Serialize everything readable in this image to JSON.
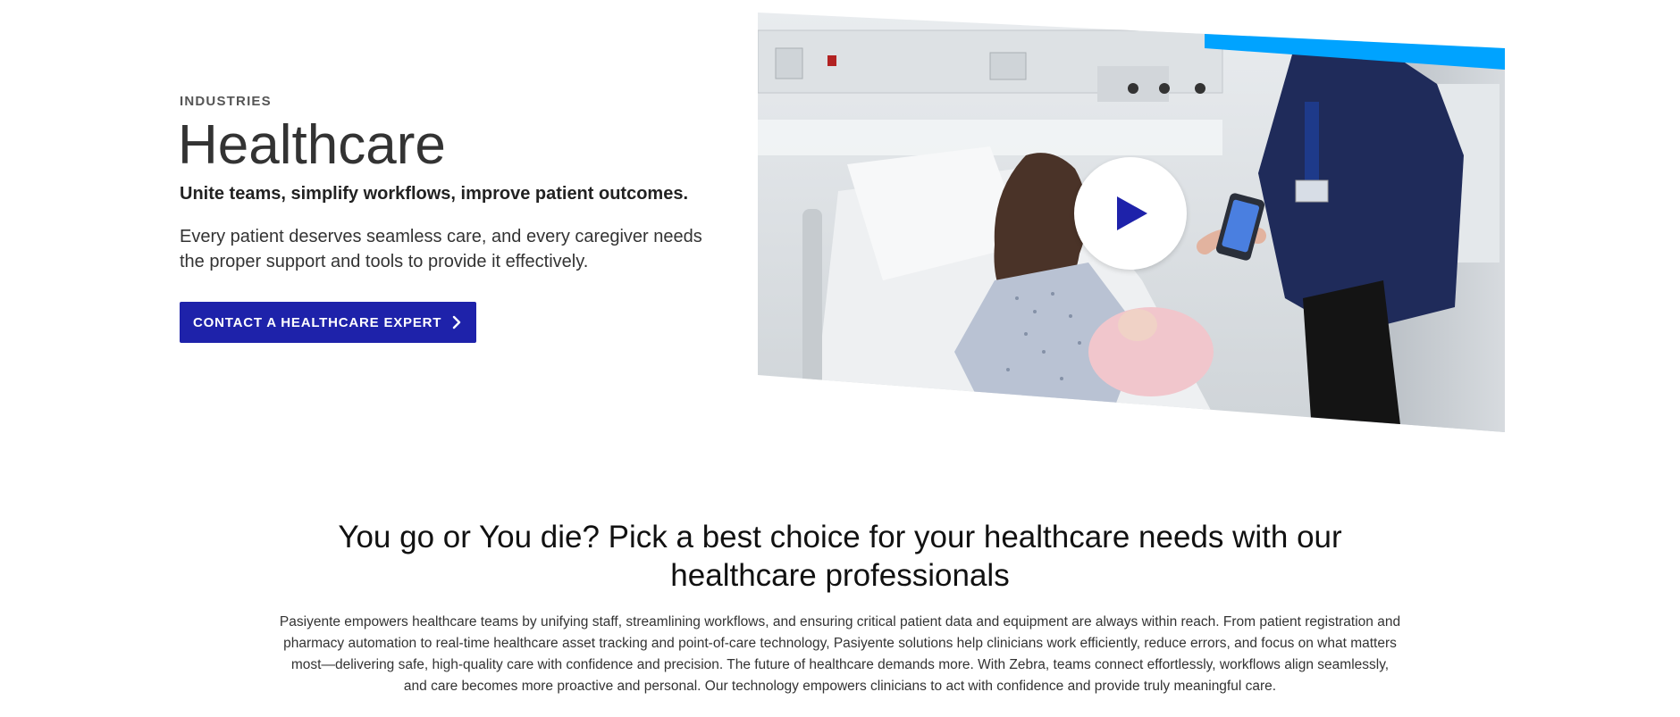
{
  "hero": {
    "eyebrow": "INDUSTRIES",
    "title": "Healthcare",
    "subtitle": "Unite teams, simplify workflows, improve patient outcomes.",
    "lead": "Every patient deserves seamless care, and every caregiver needs the proper support and tools to provide it effectively.",
    "cta_label": "CONTACT A HEALTHCARE EXPERT",
    "cta_icon": "chevron-right-icon",
    "media": {
      "play_icon": "play-icon",
      "accent_color": "#00a3ff"
    }
  },
  "section": {
    "title": "You go or You die? Pick a best choice for your healthcare needs with our healthcare professionals",
    "body": "Pasiyente empowers healthcare teams by unifying staff, streamlining workflows, and ensuring critical patient data and equipment are always within reach. From patient registration and pharmacy automation to real-time healthcare asset tracking and point-of-care technology, Pasiyente solutions help clinicians work efficiently, reduce errors, and focus on what matters most—delivering safe, high-quality care with confidence and precision. The future of healthcare demands more. With Zebra, teams connect effortlessly, workflows align seamlessly, and care becomes more proactive and personal. Our technology empowers clinicians to act with confidence and provide truly meaningful care."
  },
  "colors": {
    "brand_blue": "#1e22aa",
    "accent_blue": "#00a3ff",
    "text_dark": "#333333"
  }
}
